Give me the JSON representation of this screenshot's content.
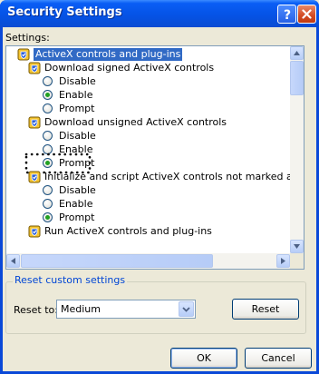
{
  "window": {
    "title": "Security Settings"
  },
  "settings_label": "Settings:",
  "tree": [
    {
      "type": "category",
      "label": "ActiveX controls and plug-ins",
      "indent": 0,
      "highlighted": true
    },
    {
      "type": "category",
      "label": "Download signed ActiveX controls",
      "indent": 1
    },
    {
      "type": "option",
      "label": "Disable",
      "selected": false
    },
    {
      "type": "option",
      "label": "Enable",
      "selected": true
    },
    {
      "type": "option",
      "label": "Prompt",
      "selected": false
    },
    {
      "type": "category",
      "label": "Download unsigned ActiveX controls",
      "indent": 1
    },
    {
      "type": "option",
      "label": "Disable",
      "selected": false
    },
    {
      "type": "option",
      "label": "Enable",
      "selected": false
    },
    {
      "type": "option",
      "label": "Prompt",
      "selected": true,
      "focused": true
    },
    {
      "type": "category",
      "label": "Initialize and script ActiveX controls not marked as safe",
      "indent": 1
    },
    {
      "type": "option",
      "label": "Disable",
      "selected": false
    },
    {
      "type": "option",
      "label": "Enable",
      "selected": false
    },
    {
      "type": "option",
      "label": "Prompt",
      "selected": true
    },
    {
      "type": "category",
      "label": "Run ActiveX controls and plug-ins",
      "indent": 1
    }
  ],
  "reset_group": {
    "label": "Reset custom settings",
    "reset_to_label": "Reset to:",
    "select_value": "Medium",
    "reset_button": "Reset"
  },
  "buttons": {
    "ok": "OK",
    "cancel": "Cancel"
  },
  "colors": {
    "title_bar": "#0a5ef5",
    "selection": "#316ac5",
    "group_label": "#0046d5"
  }
}
